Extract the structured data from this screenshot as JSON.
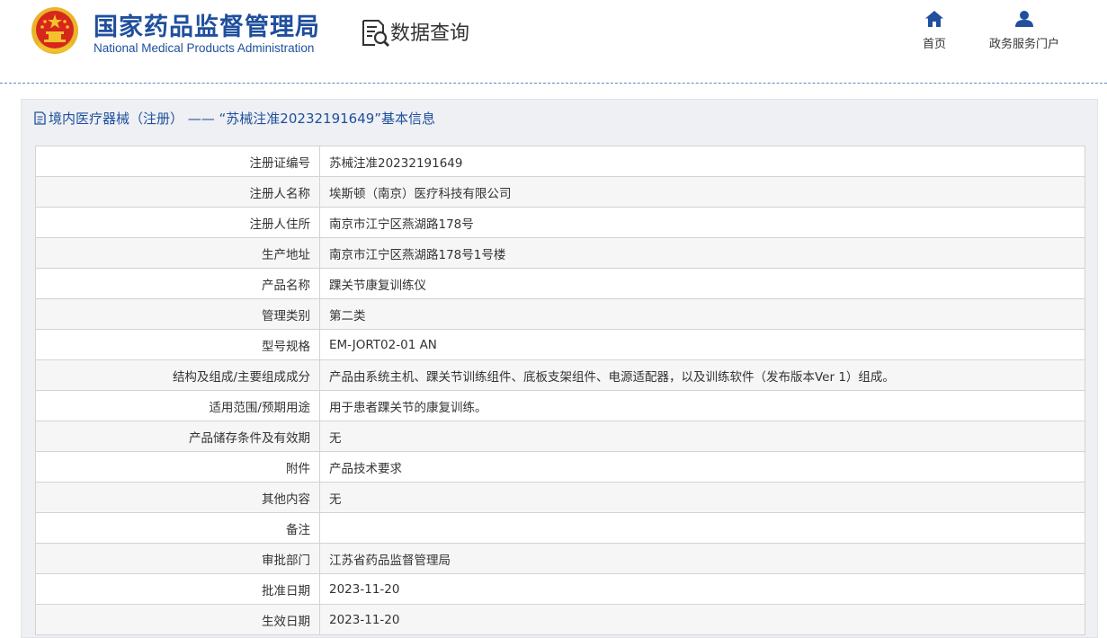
{
  "header": {
    "title_cn": "国家药品监督管理局",
    "title_en": "National Medical Products Administration",
    "query_label": "数据查询",
    "nav": [
      {
        "label": "首页",
        "icon": "home-icon"
      },
      {
        "label": "政务服务门户",
        "icon": "user-icon"
      }
    ]
  },
  "panel": {
    "title": "境内医疗器械（注册） —— “苏械注准20232191649”基本信息",
    "title_icon": "document-icon"
  },
  "rows": [
    {
      "label": "注册证编号",
      "value": "苏械注准20232191649"
    },
    {
      "label": "注册人名称",
      "value": "埃斯顿（南京）医疗科技有限公司"
    },
    {
      "label": "注册人住所",
      "value": "南京市江宁区燕湖路178号"
    },
    {
      "label": "生产地址",
      "value": "南京市江宁区燕湖路178号1号楼"
    },
    {
      "label": "产品名称",
      "value": "踝关节康复训练仪"
    },
    {
      "label": "管理类别",
      "value": "第二类"
    },
    {
      "label": "型号规格",
      "value": "EM-JORT02-01 AN"
    },
    {
      "label": "结构及组成/主要组成成分",
      "value": "产品由系统主机、踝关节训练组件、底板支架组件、电源适配器，以及训练软件（发布版本Ver 1）组成。"
    },
    {
      "label": "适用范围/预期用途",
      "value": "用于患者踝关节的康复训练。"
    },
    {
      "label": "产品储存条件及有效期",
      "value": "无"
    },
    {
      "label": "附件",
      "value": "产品技术要求"
    },
    {
      "label": "其他内容",
      "value": "无"
    },
    {
      "label": "备注",
      "value": ""
    },
    {
      "label": "审批部门",
      "value": "江苏省药品监督管理局"
    },
    {
      "label": "批准日期",
      "value": "2023-11-20"
    },
    {
      "label": "生效日期",
      "value": "2023-11-20"
    }
  ],
  "colors": {
    "brand_blue": "#1f4f9d",
    "emblem_red": "#d7261c",
    "emblem_gold": "#f3c12c",
    "row_alt_bg": "#f6f6f6"
  }
}
